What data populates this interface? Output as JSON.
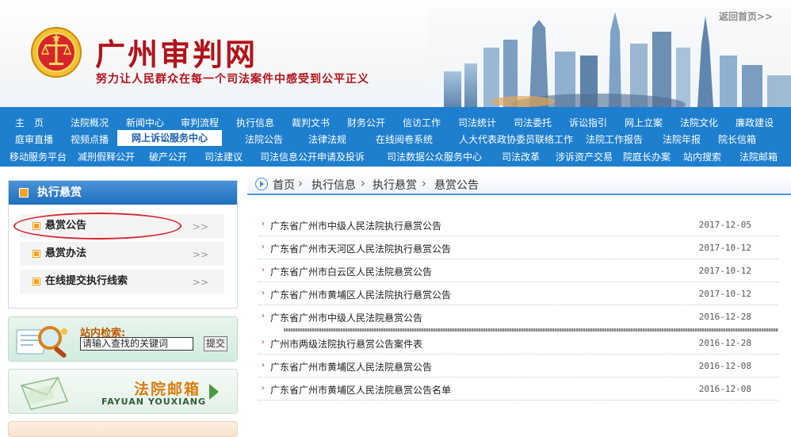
{
  "header": {
    "title": "广州审判网",
    "slogan": "努力让人民群众在每一个司法案件中感受到公平正义",
    "back_home": "返回首页>>"
  },
  "nav": {
    "rows": [
      [
        "主　页",
        "法院概况",
        "新闻中心",
        "审判流程",
        "执行信息",
        "裁判文书",
        "财务公开",
        "信访工作",
        "司法统计",
        "司法委托",
        "诉讼指引",
        "网上立案",
        "法院文化",
        "廉政建设"
      ],
      [
        "庭审直播",
        "视频点播",
        "网上诉讼服务中心",
        "法院公告",
        "法律法规",
        "在线阅卷系统",
        "人大代表政协委员联络工作",
        "法院工作报告",
        "法院年报",
        "院长信箱"
      ],
      [
        "移动服务平台",
        "减刑假释公开",
        "破产公开",
        "司法建议",
        "司法信息公开申请及投诉",
        "司法数据公众服务中心",
        "司法改革",
        "涉诉资产交易",
        "院庭长办案",
        "站内搜索",
        "法院邮箱"
      ]
    ],
    "active": "网上诉讼服务中心"
  },
  "sidebar": {
    "section_title": "执行悬赏",
    "items": [
      {
        "label": "悬赏公告",
        "more": ">>"
      },
      {
        "label": "悬赏办法",
        "more": ">>"
      },
      {
        "label": "在线提交执行线索",
        "more": ">>"
      }
    ],
    "search": {
      "label": "站内检索:",
      "input_value": "请输入查找的关键词",
      "button": "提交"
    },
    "mail": {
      "title": "法院邮箱",
      "subtitle": "FAYUAN YOUXIANG"
    }
  },
  "breadcrumb": [
    "首页",
    "执行信息",
    "执行悬赏",
    "悬赏公告"
  ],
  "list": [
    {
      "title": "广东省广州市中级人民法院执行悬赏公告",
      "date": "2017-12-05"
    },
    {
      "title": "广东省广州市天河区人民法院执行悬赏公告",
      "date": "2017-10-12"
    },
    {
      "title": "广东省广州市白云区人民法院悬赏公告",
      "date": "2017-10-12"
    },
    {
      "title": "广东省广州市黄埔区人民法院执行悬赏公告",
      "date": "2017-10-12"
    },
    {
      "title": "广东省广州市中级人民法院悬赏公告",
      "date": "2016-12-28"
    },
    {
      "title": "广州市两级法院执行悬赏公告案件表",
      "date": "2016-12-28"
    },
    {
      "title": "广东省广州市黄埔区人民法院悬赏公告",
      "date": "2016-12-08"
    },
    {
      "title": "广东省广州市黄埔区人民法院悬赏公告名单",
      "date": "2016-12-08"
    }
  ],
  "colors": {
    "nav_bg": "#1e7fcf",
    "brand_red": "#b3121a",
    "accent_orange": "#f0a020"
  }
}
